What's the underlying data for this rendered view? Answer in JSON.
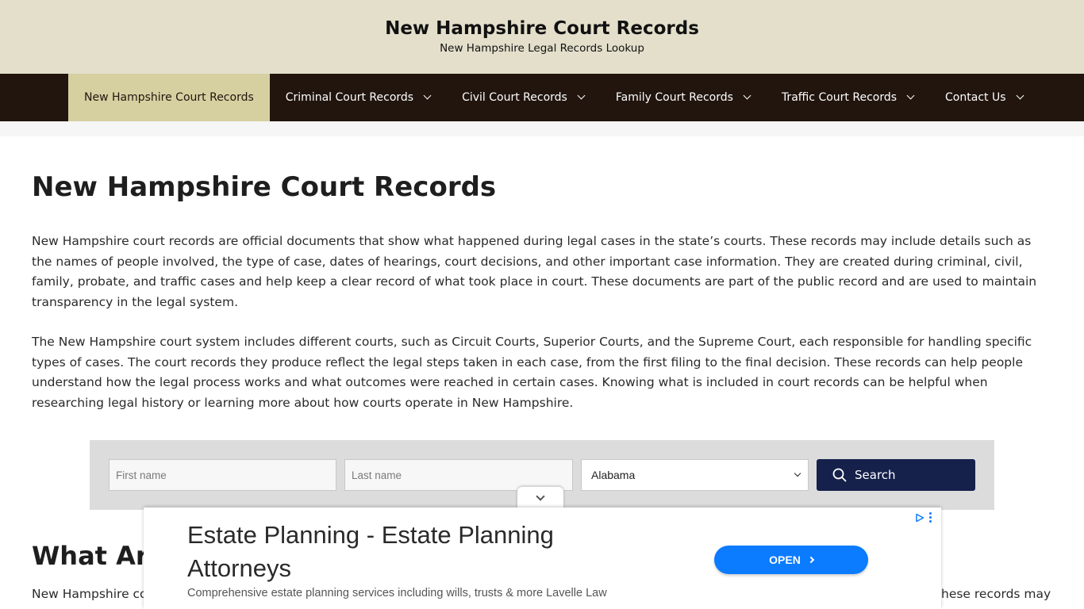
{
  "header": {
    "title": "New Hampshire Court Records",
    "tagline": "New Hampshire Legal Records Lookup"
  },
  "nav": {
    "items": [
      {
        "label": "New Hampshire Court Records",
        "active": true,
        "dropdown": false
      },
      {
        "label": "Criminal Court Records",
        "active": false,
        "dropdown": true
      },
      {
        "label": "Civil Court Records",
        "active": false,
        "dropdown": true
      },
      {
        "label": "Family Court Records",
        "active": false,
        "dropdown": true
      },
      {
        "label": "Traffic Court Records",
        "active": false,
        "dropdown": true
      },
      {
        "label": "Contact Us",
        "active": false,
        "dropdown": true
      }
    ]
  },
  "main": {
    "title": "New Hampshire Court Records",
    "paragraphs": [
      "New Hampshire court records are official documents that show what happened during legal cases in the state’s courts. These records may include details such as the names of people involved, the type of case, dates of hearings, court decisions, and other important case information. They are created during criminal, civil, family, probate, and traffic cases and help keep a clear record of what took place in court. These documents are part of the public record and are used to maintain transparency in the legal system.",
      "The New Hampshire court system includes different courts, such as Circuit Courts, Superior Courts, and the Supreme Court, each responsible for handling specific types of cases. The court records they produce reflect the legal steps taken in each case, from the first filing to the final decision. These records can help people understand how the legal process works and what outcomes were reached in certain cases. Knowing what is included in court records can be helpful when researching legal history or learning more about how courts operate in New Hampshire."
    ],
    "section_heading_visible": "What Are",
    "bottom_text_left_visible": "New Hampshire co",
    "bottom_text_right_visible": "hese records may"
  },
  "search": {
    "first_name_placeholder": "First name",
    "last_name_placeholder": "Last name",
    "state_selected": "Alabama",
    "button_label": "Search"
  },
  "ad": {
    "headline": "Estate Planning - Estate Planning Attorneys",
    "description": "Comprehensive estate planning services including wills, trusts & more Lavelle Law",
    "cta_label": "OPEN",
    "accent_color": "#0b7bff"
  },
  "colors": {
    "header_bg": "#e3dfcb",
    "nav_bg": "#21150e",
    "nav_active_bg": "#d6d0a1",
    "search_button_bg": "#15204b"
  },
  "icons": {
    "search": "search-icon",
    "dropdown": "chevron-down-icon",
    "ad_collapse": "chevron-down-icon",
    "ad_choices": "ad-choices-icon"
  }
}
